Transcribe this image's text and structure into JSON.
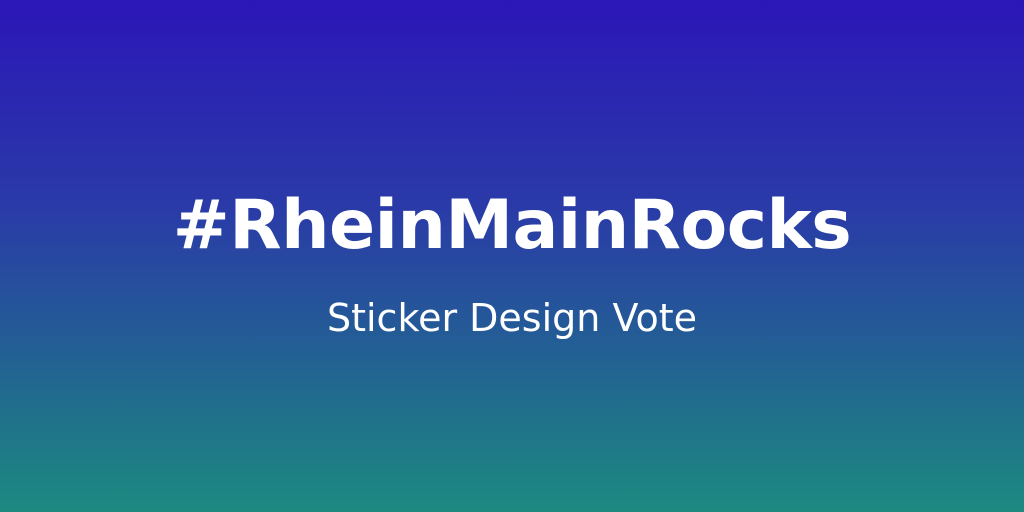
{
  "banner": {
    "title": "#RheinMainRocks",
    "subtitle": "Sticker Design Vote"
  },
  "colors": {
    "gradient_top": "#2b16b8",
    "gradient_bottom": "#1d8a80",
    "text": "#ffffff"
  }
}
